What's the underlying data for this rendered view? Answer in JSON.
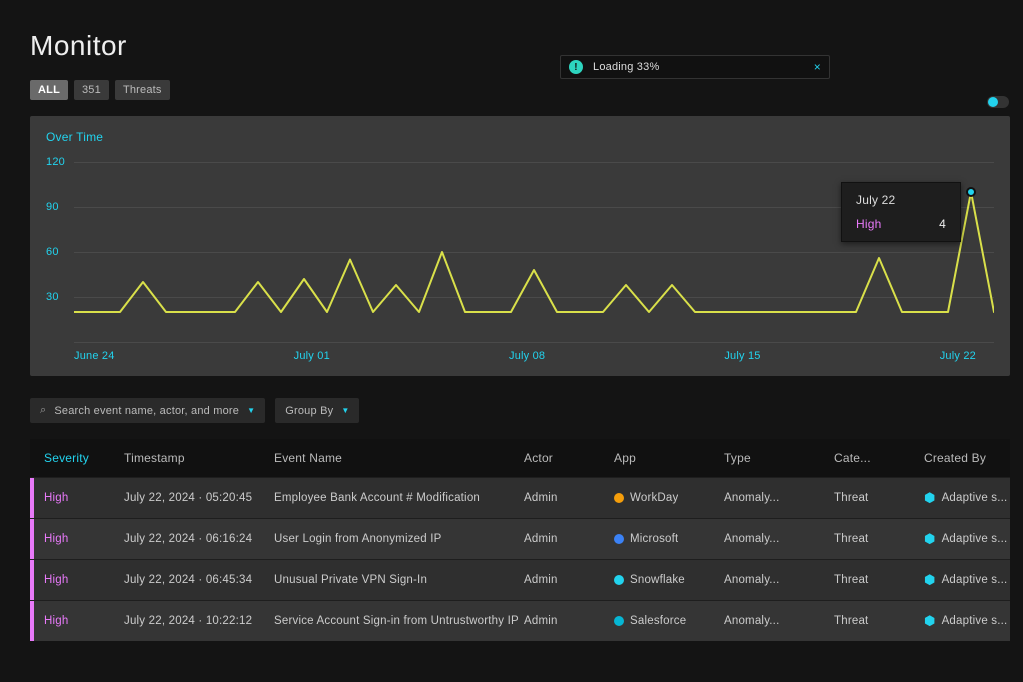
{
  "header": {
    "title": "Monitor"
  },
  "toast": {
    "icon": "alert-icon",
    "text": "Loading 33%",
    "close": "×"
  },
  "tabs": {
    "all_label": "ALL",
    "count": "351",
    "threats_label": "Threats"
  },
  "toggle": {
    "on": true
  },
  "chart_title": "Over Time",
  "chart_data": {
    "type": "line",
    "title": "Over Time",
    "xlabel": "",
    "ylabel": "",
    "ylim": [
      0,
      120
    ],
    "yticks": [
      30,
      60,
      90,
      120
    ],
    "categories": [
      "June 24",
      "July 01",
      "July 08",
      "July 15",
      "July 22"
    ],
    "series": [
      {
        "name": "High",
        "color": "#d9e04a",
        "values": [
          20,
          20,
          20,
          40,
          20,
          20,
          20,
          20,
          40,
          20,
          42,
          20,
          55,
          20,
          38,
          20,
          60,
          20,
          20,
          20,
          48,
          20,
          20,
          20,
          38,
          20,
          38,
          20,
          20,
          20,
          20,
          20,
          20,
          20,
          20,
          56,
          20,
          20,
          20,
          100,
          20
        ]
      }
    ],
    "tooltip": {
      "date": "July 22",
      "severity": "High",
      "value": 4
    }
  },
  "filters": {
    "search_placeholder": "Search event name, actor, and more",
    "groupby_label": "Group By"
  },
  "table": {
    "columns": {
      "severity": "Severity",
      "timestamp": "Timestamp",
      "event_name": "Event Name",
      "actor": "Actor",
      "app": "App",
      "type": "Type",
      "category": "Cate...",
      "created_by": "Created By"
    },
    "rows": [
      {
        "severity": "High",
        "timestamp": "July 22, 2024 · 05:20:45",
        "event_name": "Employee Bank Account # Modification",
        "actor": "Admin",
        "app": {
          "name": "WorkDay",
          "icon_color": "#f59e0b"
        },
        "type": "Anomaly...",
        "category": "Threat",
        "created_by": "Adaptive s..."
      },
      {
        "severity": "High",
        "timestamp": "July 22, 2024 · 06:16:24",
        "event_name": "User Login from Anonymized IP",
        "actor": "Admin",
        "app": {
          "name": "Microsoft",
          "icon_color": "#3b82f6"
        },
        "type": "Anomaly...",
        "category": "Threat",
        "created_by": "Adaptive s..."
      },
      {
        "severity": "High",
        "timestamp": "July 22, 2024 · 06:45:34",
        "event_name": "Unusual Private VPN Sign-In",
        "actor": "Admin",
        "app": {
          "name": "Snowflake",
          "icon_color": "#22d3ee"
        },
        "type": "Anomaly...",
        "category": "Threat",
        "created_by": "Adaptive s..."
      },
      {
        "severity": "High",
        "timestamp": "July 22, 2024 · 10:22:12",
        "event_name": "Service Account Sign-in from Untrustworthy IP",
        "actor": "Admin",
        "app": {
          "name": "Salesforce",
          "icon_color": "#06b6d4"
        },
        "type": "Anomaly...",
        "category": "Threat",
        "created_by": "Adaptive s..."
      }
    ]
  }
}
